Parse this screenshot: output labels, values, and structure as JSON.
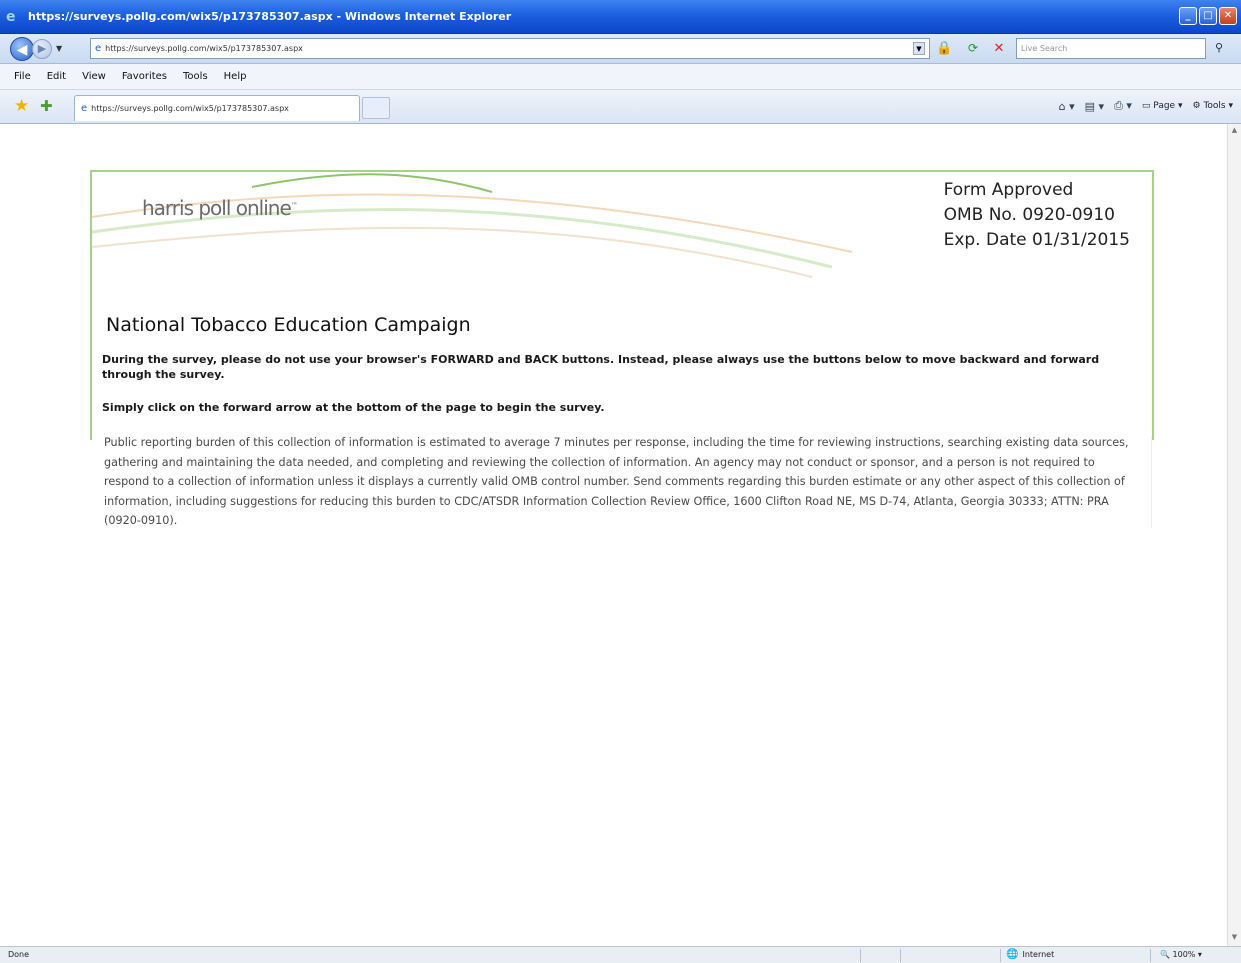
{
  "window": {
    "title": "https://surveys.pollg.com/wix5/p173785307.aspx - Windows Internet Explorer"
  },
  "address_bar": {
    "url": "https://surveys.pollg.com/wix5/p173785307.aspx",
    "search_placeholder": "Live Search"
  },
  "menu": {
    "items": [
      "File",
      "Edit",
      "View",
      "Favorites",
      "Tools",
      "Help"
    ]
  },
  "tabs": {
    "active_tab_label": "https://surveys.pollg.com/wix5/p173785307.aspx"
  },
  "command_bar": {
    "page_label": "Page",
    "tools_label": "Tools"
  },
  "survey": {
    "logo_text": "harris poll online",
    "omb": {
      "line1": "Form Approved",
      "line2": "OMB No. 0920-0910",
      "line3": "Exp. Date 01/31/2015"
    },
    "title": "National Tobacco  Education  Campaign",
    "instruction1": "During the survey, please do not use your browser's FORWARD and BACK buttons. Instead, please always use the buttons below to move backward and forward through the survey.",
    "instruction2": "Simply click on the forward arrow at the bottom of the page to begin the survey.",
    "burden_text": "Public reporting burden of this collection of information is estimated to average 7 minutes per response, including the time for reviewing instructions, searching existing data sources, gathering and maintaining the data needed, and completing and reviewing the collection of information. An agency may not conduct or sponsor, and a person is not required to respond to a collection of information unless it displays a currently valid OMB control number. Send comments regarding this burden estimate or any other aspect of this collection of information, including suggestions for reducing this burden to CDC/ATSDR Information Collection Review Office, 1600 Clifton Road NE, MS D-74, Atlanta, Georgia 30333; ATTN: PRA (0920-0910)."
  },
  "status_bar": {
    "status": "Done",
    "zone": "Internet",
    "zoom": "100%"
  },
  "colors": {
    "card_border": "#a6d18a",
    "titlebar": "#1c5fe0"
  }
}
